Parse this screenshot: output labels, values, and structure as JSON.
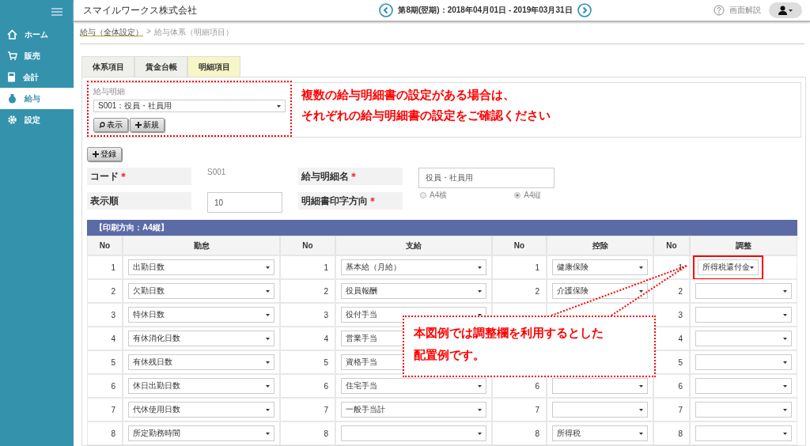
{
  "sidebar": {
    "items": [
      {
        "label": "ホーム",
        "selected": false
      },
      {
        "label": "販売",
        "selected": false
      },
      {
        "label": "会計",
        "selected": false
      },
      {
        "label": "給与",
        "selected": true
      },
      {
        "label": "設定",
        "selected": false
      }
    ]
  },
  "header": {
    "company": "スマイルワークス株式会社",
    "period": "第8期(翌期)：2018年04月01日 - 2019年03月31日",
    "help": "画面解説"
  },
  "breadcrumb": {
    "link": "給与（全体設定）",
    "separator": ">",
    "current": "給与体系（明細項目）"
  },
  "tabs": [
    {
      "label": "体系項目",
      "selected": false
    },
    {
      "label": "賃金台帳",
      "selected": false
    },
    {
      "label": "明細項目",
      "selected": true
    }
  ],
  "selector": {
    "label": "給与明細",
    "value": "S001：役員・社員用",
    "buttons": [
      {
        "label": "表示"
      },
      {
        "label": "新規"
      }
    ]
  },
  "note_top": [
    "複数の給与明細書の設定がある場合は、",
    "それぞれの給与明細書の設定をご確認ください"
  ],
  "register_button": "登録",
  "form": {
    "code_label": "コード",
    "code_value": "S001",
    "name_label": "給与明細名",
    "name_value": "役員・社員用",
    "order_label": "表示順",
    "order_value": "10",
    "direction_label": "明細書印字方向",
    "required_mark": "＊",
    "directions": [
      {
        "label": "A4横",
        "selected": false
      },
      {
        "label": "A4縦",
        "selected": true
      }
    ]
  },
  "table": {
    "title": "【印刷方向：A4縦】",
    "columns": [
      "No",
      "勤怠",
      "No",
      "支給",
      "No",
      "控除",
      "No",
      "調整"
    ],
    "rows": [
      {
        "attendance": {
          "no": "1",
          "value": "出勤日数"
        },
        "payment": {
          "no": "1",
          "value": "基本給（月給）"
        },
        "deduction": {
          "no": "1",
          "value": "健康保険"
        },
        "adjustment": {
          "no": "1",
          "value": "所得税還付金"
        }
      },
      {
        "attendance": {
          "no": "2",
          "value": "欠勤日数"
        },
        "payment": {
          "no": "2",
          "value": "役員報酬"
        },
        "deduction": {
          "no": "2",
          "value": "介護保険"
        },
        "adjustment": {
          "no": "2"
        }
      },
      {
        "attendance": {
          "no": "3",
          "value": "特休日数"
        },
        "payment": {
          "no": "3",
          "value": "役付手当"
        },
        "adjustment": {
          "no": "3"
        }
      },
      {
        "attendance": {
          "no": "4",
          "value": "有休消化日数"
        },
        "payment": {
          "no": "4",
          "value": "営業手当"
        },
        "adjustment": {
          "no": "4"
        }
      },
      {
        "attendance": {
          "no": "5",
          "value": "有休残日数"
        },
        "payment": {
          "no": "5",
          "value": "資格手当"
        },
        "adjustment": {
          "no": "5"
        }
      },
      {
        "attendance": {
          "no": "6",
          "value": "休日出勤日数"
        },
        "payment": {
          "no": "6",
          "value": "住宅手当"
        },
        "deduction": {
          "no": "6"
        },
        "adjustment": {
          "no": "6"
        }
      },
      {
        "attendance": {
          "no": "7",
          "value": "代休使用日数"
        },
        "payment": {
          "no": "7",
          "value": "一般手当計"
        },
        "deduction": {
          "no": "7"
        },
        "adjustment": {
          "no": "7"
        }
      },
      {
        "attendance": {
          "no": "8",
          "value": "所定勤務時間"
        },
        "payment": {
          "no": "8"
        },
        "deduction": {
          "no": "8",
          "value": "所得税"
        },
        "adjustment": {
          "no": "8"
        }
      }
    ]
  },
  "note_bottom": [
    "本図例では調整欄を利用するとした",
    "配置例です。"
  ]
}
